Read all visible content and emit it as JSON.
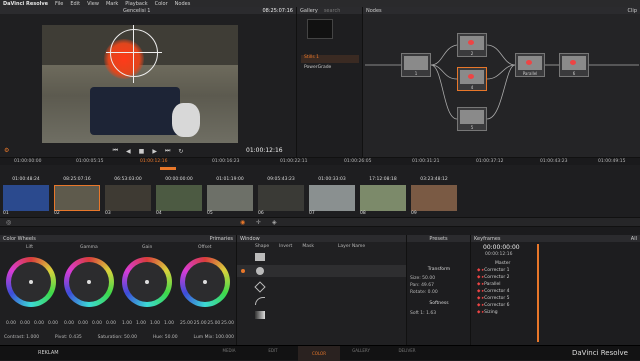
{
  "menubar": {
    "app": "DaVinci Resolve",
    "items": [
      "File",
      "Edit",
      "View",
      "Mark",
      "Playback",
      "Color",
      "Nodes"
    ]
  },
  "viewer": {
    "title": "Gencelisi 1",
    "timecode_top": "08:25:07:16",
    "timecode_main": "01:00:12:16"
  },
  "gallery": {
    "title": "Gallery",
    "search": "search",
    "stills": "Stills 1",
    "power": "PowerGrade"
  },
  "nodes": {
    "title": "Nodes",
    "clip": "Clip",
    "labels": [
      "1",
      "2",
      "4",
      "5",
      "Parallel",
      "6"
    ]
  },
  "ruler": [
    "01:00:00:00",
    "01:00:05:15",
    "01:00:12:16",
    "01:00:16:23",
    "01:00:22:11",
    "01:00:26:05",
    "01:00:31:21",
    "01:00:37:12",
    "01:00:43:23",
    "01:00:49:15"
  ],
  "clips": [
    {
      "tc": "01:00:48:24",
      "n": "01",
      "v": "V1"
    },
    {
      "tc": "08:25:07:16",
      "n": "02",
      "v": "V1"
    },
    {
      "tc": "06:53:03:00",
      "n": "03",
      "v": "V1"
    },
    {
      "tc": "00:00:00:00",
      "n": "04",
      "v": "V1"
    },
    {
      "tc": "01:01:19:00",
      "n": "05",
      "v": "V1"
    },
    {
      "tc": "09:05:43:23",
      "n": "06",
      "v": "V1"
    },
    {
      "tc": "01:00:33:03",
      "n": "07",
      "v": "V1"
    },
    {
      "tc": "17:12:08:18",
      "n": "08",
      "v": "V1"
    },
    {
      "tc": "03:23:48:12",
      "n": "09",
      "v": "V1"
    }
  ],
  "wheels": {
    "title": "Color Wheels",
    "primaries": "Primaries",
    "names": [
      "Lift",
      "Gamma",
      "Gain",
      "Offset"
    ],
    "vals": [
      [
        "0.00",
        "0.00",
        "0.00",
        "0.00"
      ],
      [
        "0.00",
        "0.00",
        "0.00",
        "0.00"
      ],
      [
        "1.00",
        "1.00",
        "1.00",
        "1.00"
      ],
      [
        "25.00",
        "25.00",
        "25.00",
        "25.00"
      ]
    ],
    "contrast": "Contrast: 1.000",
    "pivot": "Pivot: 0.435",
    "saturation": "Saturation: 50.00",
    "hue": "Hue: 50.00",
    "lum": "Lum Mix: 100.000"
  },
  "window": {
    "title": "Window",
    "cols": [
      "Shape",
      "Invert",
      "Mask",
      "Layer Name"
    ]
  },
  "presets": {
    "title": "Presets",
    "transform": "Transform",
    "size": "Size: 50.00",
    "aspect": "Aspect: 50.00",
    "pan": "Pan: 49.67",
    "tilt": "Tilt: 55.75",
    "rotate": "Rotate: 0.00",
    "softness": "Softness",
    "soft1": "Soft 1: 1.63",
    "soft2": "Soft 2: 50.00"
  },
  "keyframes": {
    "title": "Keyframes",
    "tc": "00:00:00:00",
    "tc2": "00:00:12:16",
    "all": "All",
    "rows": [
      "Master",
      "Corrector 1",
      "Corrector 2",
      "Parallel",
      "Corrector 4",
      "Corrector 5",
      "Corrector 6",
      "Sizing"
    ]
  },
  "bottom": {
    "label": "REKLAM",
    "tabs": [
      "MEDIA",
      "EDIT",
      "COLOR",
      "GALLERY",
      "DELIVER"
    ],
    "brand": "DaVinci Resolve"
  },
  "colors": {
    "accent": "#e8772a",
    "red": "#e33"
  }
}
